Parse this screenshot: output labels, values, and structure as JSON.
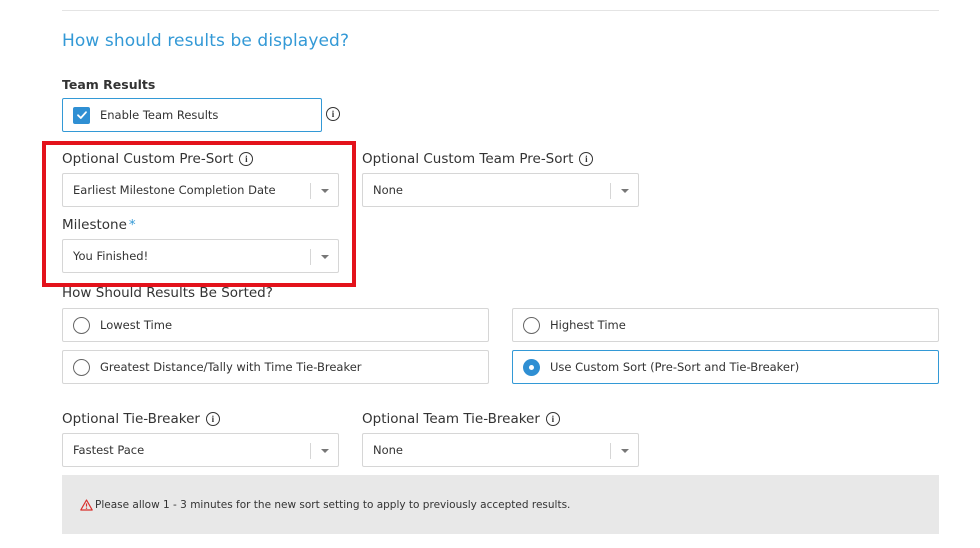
{
  "section": {
    "title": "How should results be displayed?"
  },
  "team_results": {
    "label": "Team Results",
    "checkbox_label": "Enable Team Results",
    "checked": true
  },
  "pre_sort": {
    "label": "Optional Custom Pre-Sort",
    "value": "Earliest Milestone Completion Date"
  },
  "team_pre_sort": {
    "label": "Optional Custom Team Pre-Sort",
    "value": "None"
  },
  "milestone": {
    "label": "Milestone",
    "required_mark": "*",
    "value": "You Finished!"
  },
  "sort": {
    "label": "How Should Results Be Sorted?",
    "options": [
      {
        "label": "Lowest Time",
        "selected": false
      },
      {
        "label": "Highest Time",
        "selected": false
      },
      {
        "label": "Greatest Distance/Tally with Time Tie-Breaker",
        "selected": false
      },
      {
        "label": "Use Custom Sort (Pre-Sort and Tie-Breaker)",
        "selected": true
      }
    ]
  },
  "tie_breaker": {
    "label": "Optional Tie-Breaker",
    "value": "Fastest Pace"
  },
  "team_tie_breaker": {
    "label": "Optional Team Tie-Breaker",
    "value": "None"
  },
  "notice": {
    "text": "Please allow 1 - 3 minutes for the new sort setting to apply to previously accepted results."
  },
  "colors": {
    "accent": "#3399d6",
    "highlight": "#e3121b",
    "warning": "#d9302c"
  },
  "icons": {
    "info": "info-circle-icon",
    "check": "checkmark-icon",
    "caret": "chevron-down-icon",
    "warning": "warning-triangle-icon"
  }
}
